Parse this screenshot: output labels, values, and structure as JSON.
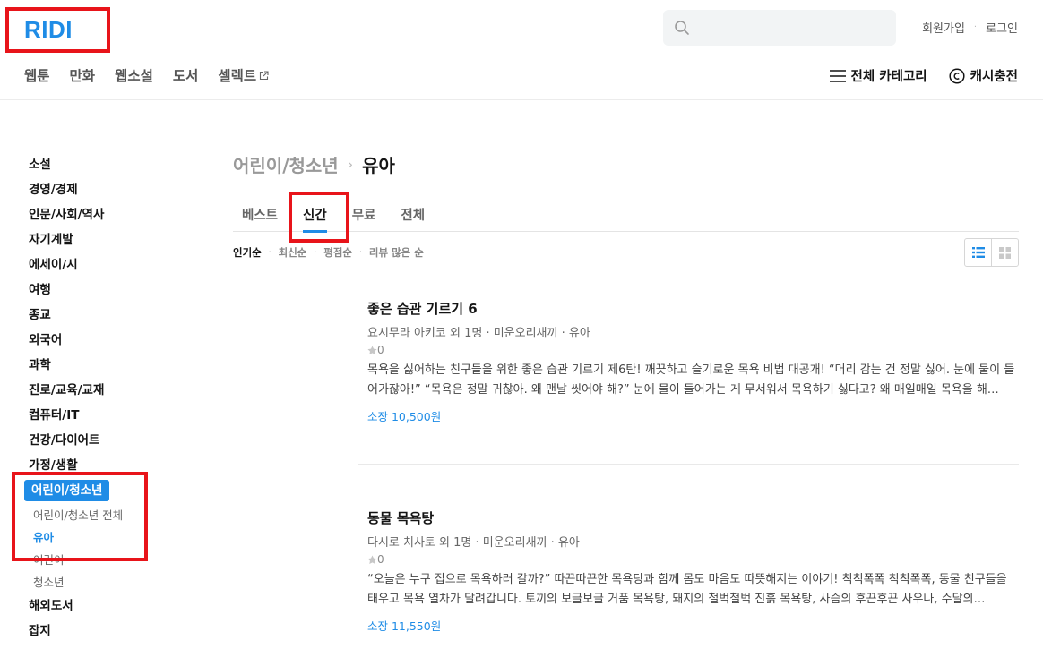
{
  "header": {
    "logo": "RIDI",
    "auth": {
      "signup": "회원가입",
      "login": "로그인"
    },
    "gnb": [
      "웹툰",
      "만화",
      "웹소설",
      "도서",
      "셀렉트"
    ],
    "util": {
      "category": "전체 카테고리",
      "cash": "캐시충전"
    }
  },
  "sidebar": {
    "categories_top": [
      "소설",
      "경영/경제",
      "인문/사회/역사",
      "자기계발",
      "에세이/시",
      "여행",
      "종교",
      "외국어",
      "과학",
      "진로/교육/교재",
      "컴퓨터/IT",
      "건강/다이어트",
      "가정/생활"
    ],
    "active_category": "어린이/청소년",
    "subcategories": [
      "어린이/청소년 전체",
      "유아",
      "어린이",
      "청소년"
    ],
    "active_subcategory_index": 1,
    "categories_bottom": [
      "해외도서",
      "잡지"
    ]
  },
  "breadcrumb": {
    "parent": "어린이/청소년",
    "current": "유아"
  },
  "tabs": [
    "베스트",
    "신간",
    "무료",
    "전체"
  ],
  "active_tab_index": 1,
  "sorts": [
    "인기순",
    "최신순",
    "평점순",
    "리뷰 많은 순"
  ],
  "active_sort_index": 0,
  "books": [
    {
      "title": "좋은 습관 기르기 6",
      "meta": "요시무라 아키코 외 1명 · 미운오리새끼 · 유아",
      "rating": "0",
      "desc": "목욕을 싫어하는 친구들을 위한 좋은 습관 기르기 제6탄! 깨끗하고 슬기로운 목욕 비법 대공개! “머리 감는 건 정말 싫어. 눈에 물이 들어가잖아!” “목욕은 정말 귀찮아. 왜 맨날 씻어야 해?” 눈에 물이 들어가는 게 무서워서 목욕하기 싫다고? 왜 매일매일 목욕을 해…",
      "price": "소장 10,500원"
    },
    {
      "title": "동물 목욕탕",
      "meta": "다시로 치사토 외 1명 · 미운오리새끼 · 유아",
      "rating": "0",
      "desc": "“오늘은 누구 집으로 목욕하러 갈까?” 따끈따끈한 목욕탕과 함께 몸도 마음도 따뜻해지는 이야기! 칙칙폭폭 칙칙폭폭, 동물 친구들을 태우고 목욕 열차가 달려갑니다. 토끼의 보글보글 거품 목욕탕, 돼지의 철벅철벅 진흙 목욕탕, 사슴의 후끈후끈 사우나, 수달의…",
      "price": "소장 11,550원"
    }
  ],
  "colors": {
    "brand": "#1f8ce6",
    "highlight": "#e8141a"
  }
}
